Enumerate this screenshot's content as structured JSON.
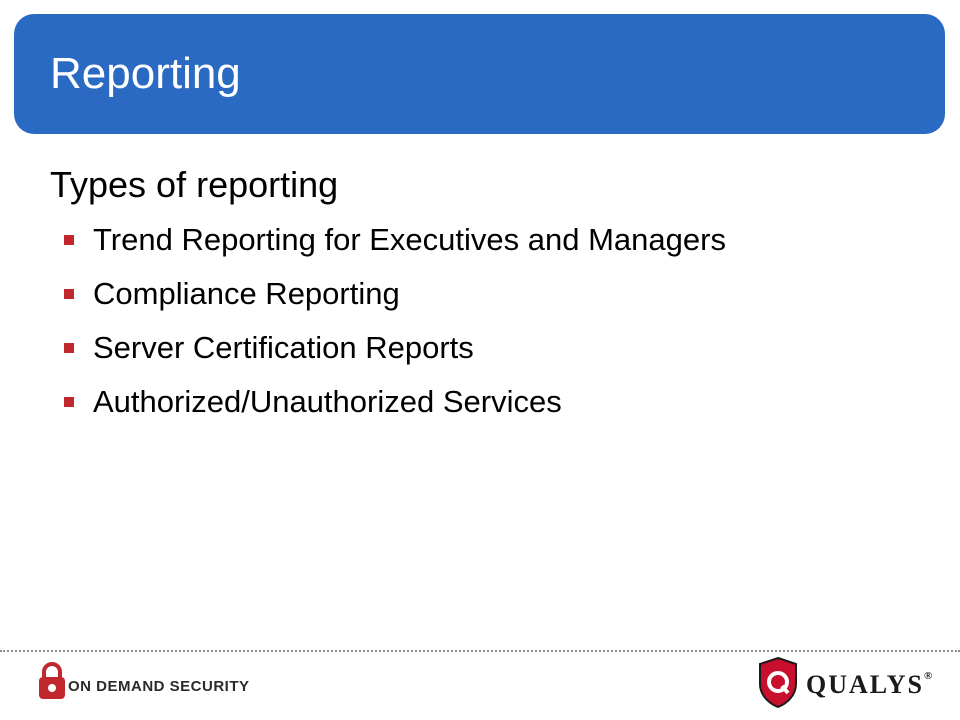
{
  "header": {
    "title": "Reporting"
  },
  "content": {
    "subheading": "Types of reporting",
    "bullets": [
      {
        "label": "Trend Reporting for Executives and Managers"
      },
      {
        "label": "Compliance Reporting"
      },
      {
        "label": "Server Certification Reports"
      },
      {
        "label": "Authorized/Unauthorized Services"
      }
    ]
  },
  "footer": {
    "left_logo_text": "ON DEMAND SECURITY",
    "right_logo_text": "QUALYS",
    "right_logo_mark": "®"
  },
  "colors": {
    "title_bar": "#2a6ac3",
    "bullet": "#c0282d",
    "qualys_shield": "#c8102e"
  },
  "icons": {
    "bullet": "square-bullet-icon",
    "left_logo": "padlock-logo-icon",
    "right_logo": "shield-q-logo-icon"
  }
}
